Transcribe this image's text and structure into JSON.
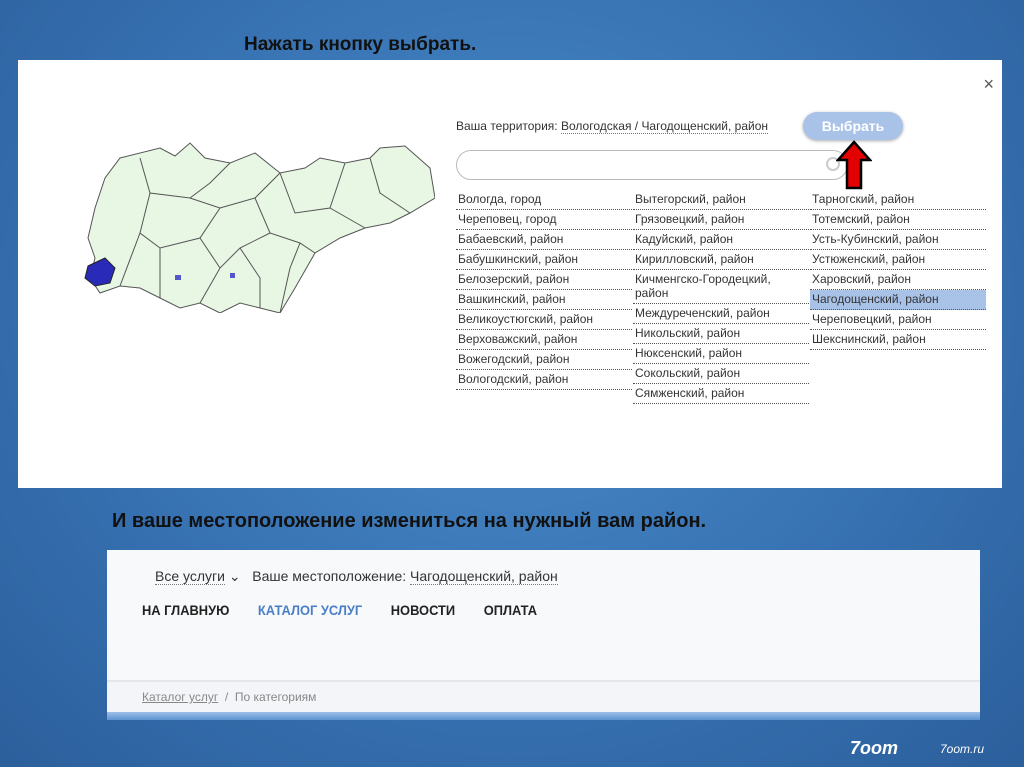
{
  "captions": {
    "top": "Нажать кнопку выбрать.",
    "bottom": "И ваше местоположение измениться на нужный вам район."
  },
  "dialog": {
    "close": "×",
    "territory_label": "Ваша территория:",
    "territory_value": "Вологодская / Чагодощенский, район",
    "select_button": "Выбрать",
    "search_placeholder": "",
    "columns": [
      [
        "Вологда, город",
        "Череповец, город",
        "Бабаевский, район",
        "Бабушкинский, район",
        "Белозерский, район",
        "Вашкинский, район",
        "Великоустюгский, район",
        "Верховажский, район",
        "Вожегодский, район",
        "Вологодский, район"
      ],
      [
        "Вытегорский, район",
        "Грязовецкий, район",
        "Кадуйский, район",
        "Кирилловский, район",
        "Кичменгско-Городецкий, район",
        "Междуреченский, район",
        "Никольский, район",
        "Нюксенский, район",
        "Сокольский, район",
        "Сямженский, район"
      ],
      [
        "Тарногский, район",
        "Тотемский, район",
        "Усть-Кубинский, район",
        "Устюженский, район",
        "Харовский, район",
        "Чагодощенский, район",
        "Череповецкий, район",
        "Шекснинский, район"
      ]
    ],
    "selected": "Чагодощенский, район"
  },
  "site": {
    "all_services": "Все услуги",
    "location_label": "Ваше местоположение:",
    "location_value": "Чагодощенский, район",
    "nav": [
      "НА ГЛАВНУЮ",
      "КАТАЛОГ УСЛУГ",
      "НОВОСТИ",
      "ОПЛАТА"
    ],
    "active_nav": "КАТАЛОГ УСЛУГ",
    "breadcrumb": [
      "Каталог услуг",
      "По категориям"
    ],
    "breadcrumb_sep": "/"
  },
  "footer": {
    "logo": "7oom",
    "site": "7oom.ru"
  },
  "colors": {
    "accent": "#a9c2e8",
    "nav_active": "#4a7fc8",
    "arrow": "#e30000"
  }
}
